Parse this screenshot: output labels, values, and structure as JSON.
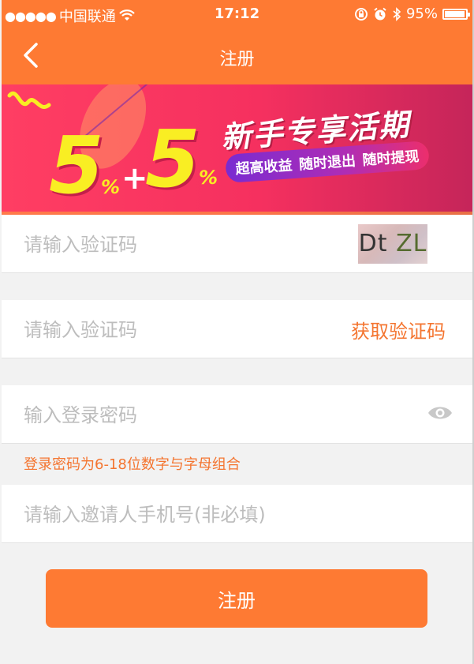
{
  "status_bar": {
    "signal": "●●●●●",
    "carrier": "中国联通",
    "time": "17:12",
    "battery_percent": "95%",
    "battery_level": 0.95
  },
  "nav": {
    "title": "注册",
    "back_icon": "chevron-left-icon"
  },
  "banner": {
    "rate_left": "5",
    "plus": "+",
    "rate_right": "5",
    "percent_sign": "%",
    "headline": "新手专享活期",
    "tags": [
      "超高收益",
      "随时退出",
      "随时提现"
    ]
  },
  "form": {
    "image_code_placeholder": "请输入验证码",
    "captcha_text_a": "Dt",
    "captcha_text_b": "ZL",
    "sms_code_placeholder": "请输入验证码",
    "get_code_label": "获取验证码",
    "password_placeholder": "输入登录密码",
    "password_hint": "登录密码为6-18位数字与字母组合",
    "inviter_placeholder": "请输入邀请人手机号(非必填)",
    "submit_label": "注册"
  },
  "colors": {
    "accent": "#fe7a33",
    "hint_text": "#f47530",
    "banner_yellow": "#f9ee23"
  }
}
